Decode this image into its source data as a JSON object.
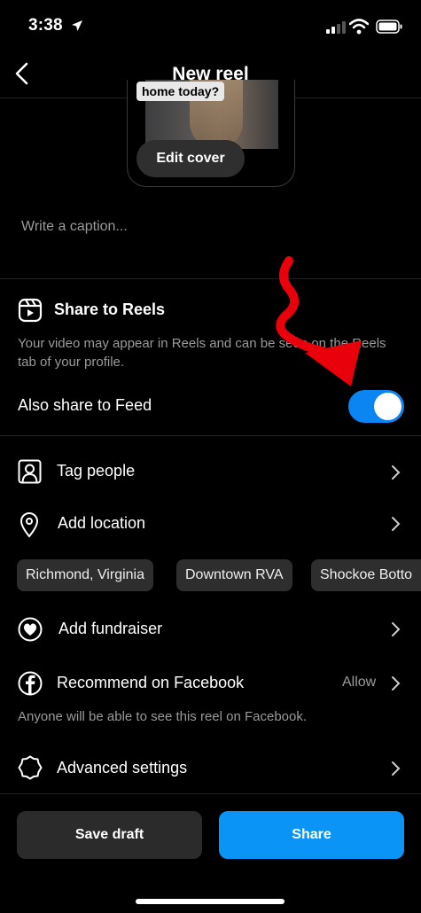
{
  "status_bar": {
    "time": "3:38"
  },
  "header": {
    "title": "New reel"
  },
  "cover": {
    "overlay_text": "home today?",
    "edit_label": "Edit cover"
  },
  "caption": {
    "placeholder": "Write a caption..."
  },
  "reels_section": {
    "title": "Share to Reels",
    "description": "Your video may appear in Reels and can be seen on the Reels tab of your profile.",
    "feed_label": "Also share to Feed",
    "feed_toggle_on": true
  },
  "rows": {
    "tag_people": "Tag people",
    "add_location": "Add location",
    "add_fundraiser": "Add fundraiser",
    "recommend_facebook": "Recommend on Facebook",
    "recommend_value": "Allow",
    "facebook_note": "Anyone will be able to see this reel on Facebook.",
    "advanced_settings": "Advanced settings"
  },
  "location_chips": [
    "Richmond, Virginia",
    "Downtown RVA",
    "Shockoe Botto"
  ],
  "buttons": {
    "save_draft": "Save draft",
    "share": "Share"
  },
  "colors": {
    "accent": "#0a95f6",
    "toggle_on": "#0a85f2",
    "annotation_arrow": "#e8000b"
  }
}
